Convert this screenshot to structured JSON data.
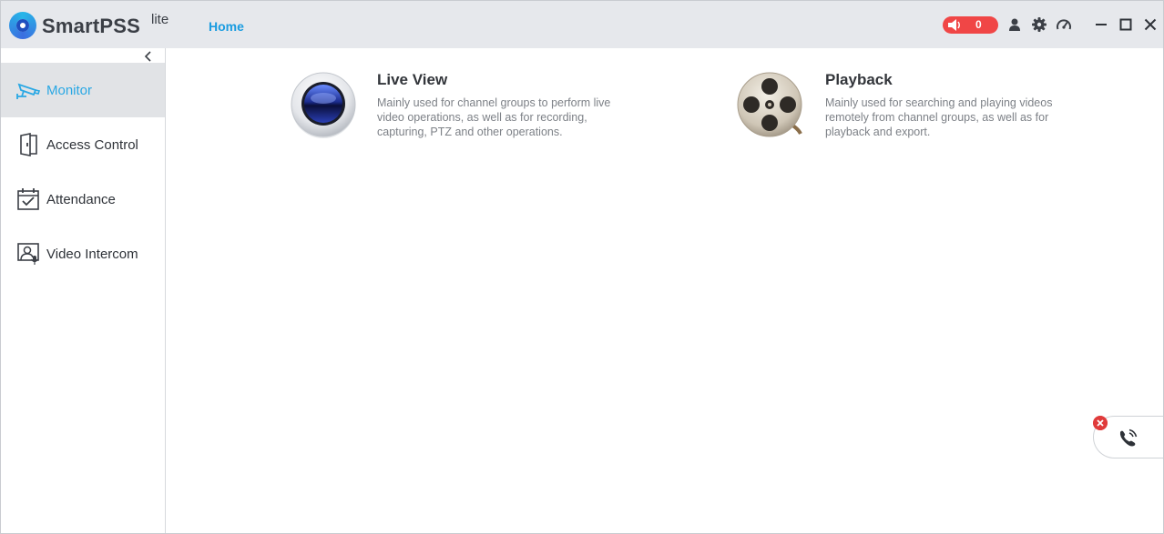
{
  "titlebar": {
    "app_name": "SmartPSS",
    "app_edition": "lite",
    "home_tab": "Home",
    "alarm_count": "0",
    "icons": [
      "speaker-icon",
      "user-icon",
      "gear-icon",
      "gauge-icon",
      "minimize-icon",
      "maximize-icon",
      "close-icon"
    ]
  },
  "sidebar": {
    "collapse_icon": "chevron-left-icon",
    "items": [
      {
        "label": "Monitor",
        "icon": "cctv-camera-icon",
        "active": true
      },
      {
        "label": "Access Control",
        "icon": "door-icon",
        "active": false
      },
      {
        "label": "Attendance",
        "icon": "calendar-check-icon",
        "active": false
      },
      {
        "label": "Video Intercom",
        "icon": "intercom-icon",
        "active": false
      }
    ]
  },
  "main": {
    "modules": [
      {
        "title": "Live View",
        "description": "Mainly used for channel groups to perform live video operations, as well as for recording, capturing, PTZ and other operations.",
        "icon": "camera-lens-icon"
      },
      {
        "title": "Playback",
        "description": "Mainly used for searching and playing videos remotely from channel groups, as well as for playback and export.",
        "icon": "film-reel-icon"
      }
    ]
  },
  "call_widget": {
    "icon": "phone-ringing-icon",
    "dismiss_icon": "close-badge-icon"
  },
  "colors": {
    "accent": "#1a9ce0",
    "alarm": "#f04646",
    "titlebar": "#e6e8ec",
    "sidebar_active": "#e1e3e6"
  }
}
